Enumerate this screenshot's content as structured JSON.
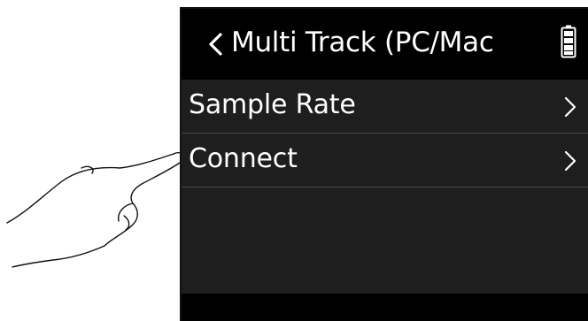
{
  "screen": {
    "title": "Multi Track (PC/Mac",
    "back_icon": "chevron-left-icon",
    "battery_icon": "battery-full-icon"
  },
  "menu": {
    "items": [
      {
        "label": "Sample Rate",
        "icon": "chevron-right-icon"
      },
      {
        "label": "Connect",
        "icon": "chevron-right-icon"
      }
    ]
  },
  "colors": {
    "screen_bg": "#1e1e1e",
    "titlebar_bg": "#000000",
    "text": "#ffffff",
    "divider": "#4a4a4a"
  },
  "illustration": {
    "icon": "pointing-hand-icon"
  }
}
